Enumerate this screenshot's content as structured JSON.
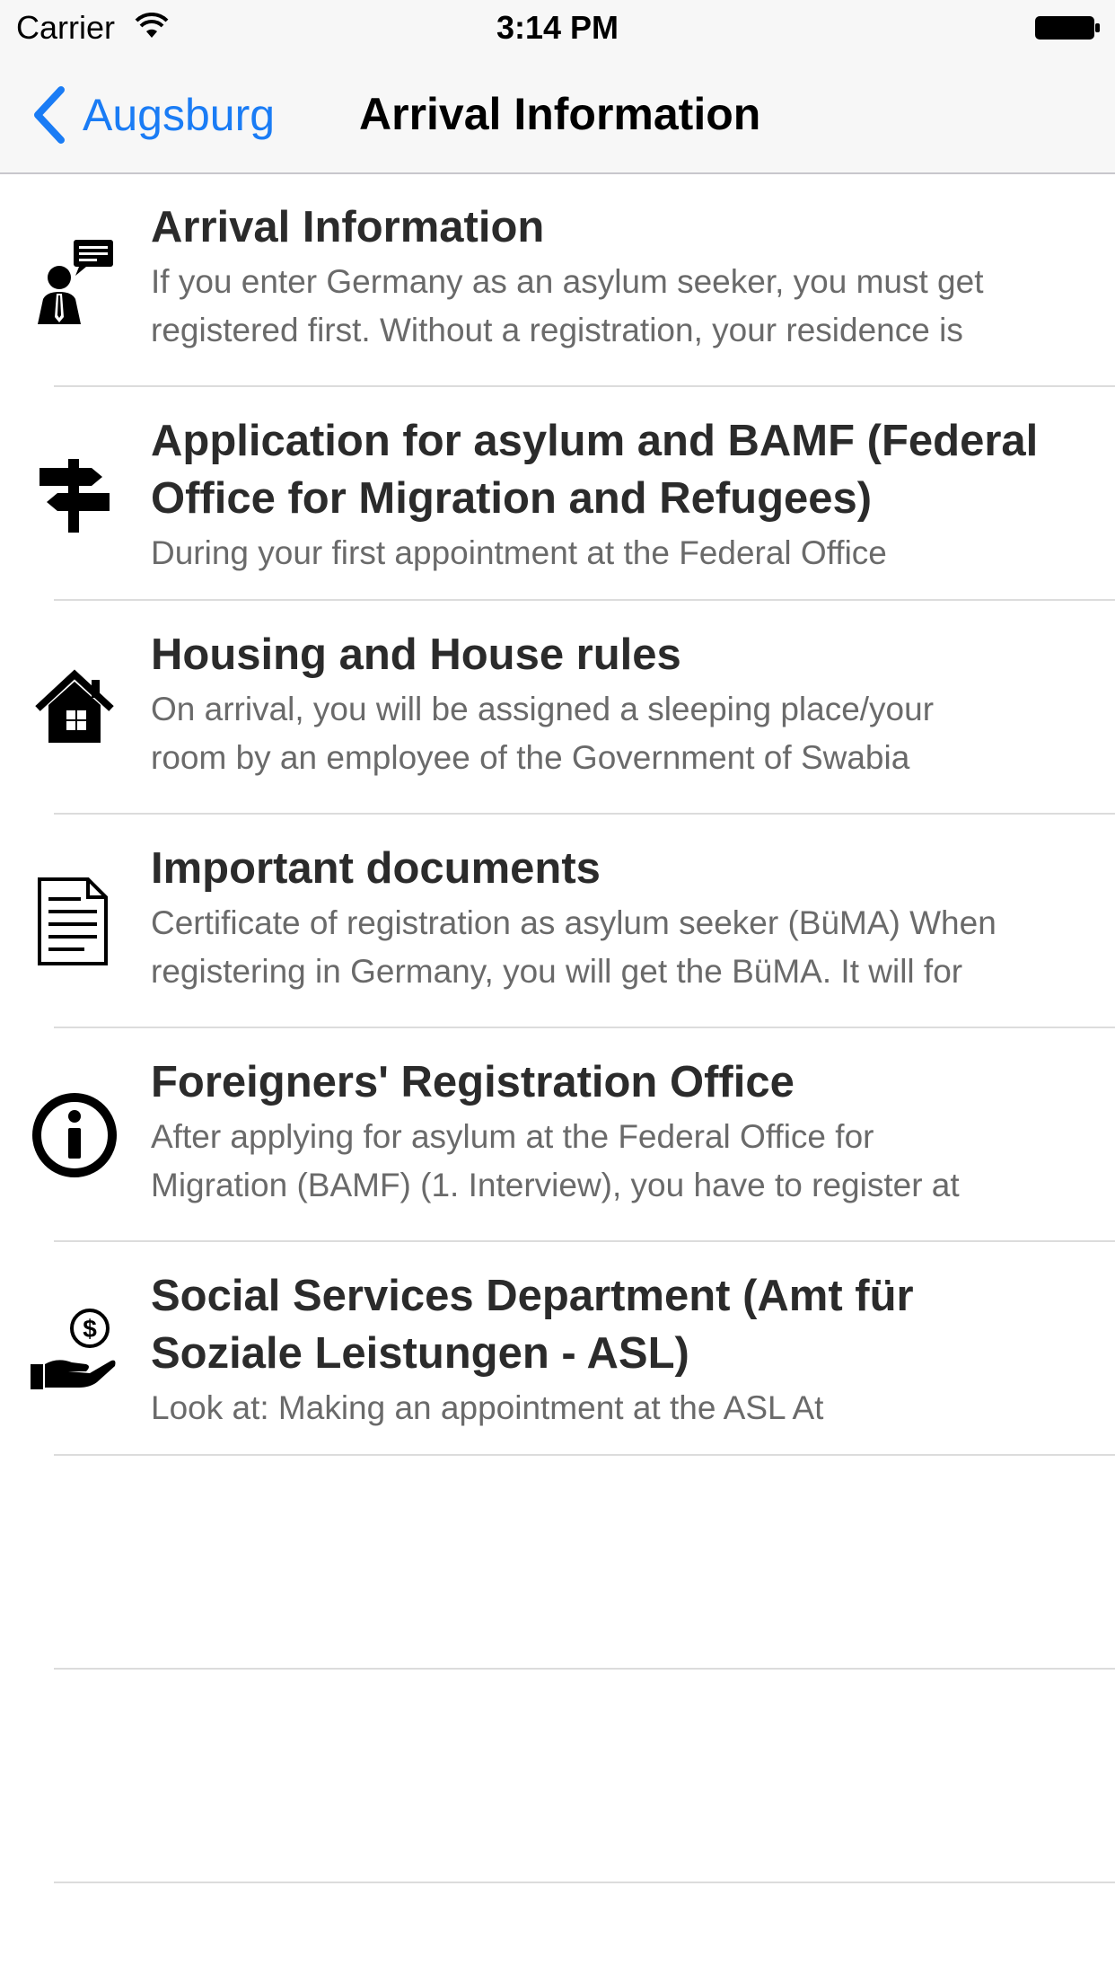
{
  "status_bar": {
    "carrier": "Carrier",
    "time": "3:14 PM"
  },
  "nav": {
    "back_label": "Augsburg",
    "title": "Arrival Information"
  },
  "colors": {
    "accent": "#1a7cf5",
    "title_text": "#2b2b2b",
    "subtitle_text": "#6a6a6a",
    "separator": "#dcdcdc"
  },
  "items": [
    {
      "icon": "person-speech-icon",
      "title": "Arrival Information",
      "desc_lines": [
        "If you enter Germany as an asylum seeker, you must get",
        "registered first. Without a registration, your residence is"
      ]
    },
    {
      "icon": "signpost-icon",
      "title_lines": [
        "Application for asylum and BAMF (Federal",
        "Office for Migration and Refugees)"
      ],
      "desc_lines": [
        "During your first appointment at the Federal Office"
      ]
    },
    {
      "icon": "house-icon",
      "title": "Housing and House rules",
      "desc_lines": [
        "On arrival, you will be assigned a sleeping place/your",
        "room by an employee of the Government of Swabia"
      ]
    },
    {
      "icon": "document-icon",
      "title": "Important documents",
      "desc_lines": [
        "Certificate of registration as asylum seeker (BüMA) When",
        "registering in Germany, you will get the BüMA. It will for"
      ]
    },
    {
      "icon": "info-icon",
      "title": "Foreigners' Registration Office",
      "desc_lines": [
        "After applying for asylum at the Federal Office for",
        "Migration (BAMF) (1. Interview), you have to register at"
      ]
    },
    {
      "icon": "money-hand-icon",
      "title_lines": [
        "Social Services Department (Amt für",
        "Soziale Leistungen - ASL)"
      ],
      "desc_lines": [
        "Look at: Making an appointment at the ASL  At"
      ]
    }
  ]
}
